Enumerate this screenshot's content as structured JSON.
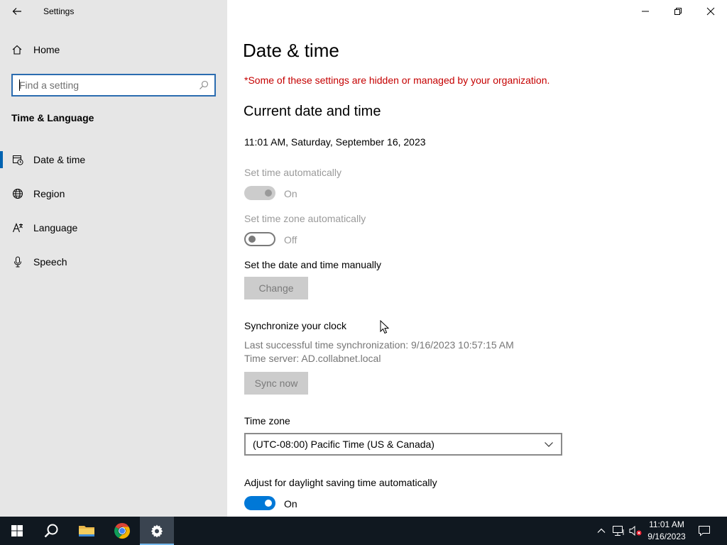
{
  "app": {
    "title": "Settings"
  },
  "sidebar": {
    "home_label": "Home",
    "search_placeholder": "Find a setting",
    "section_title": "Time & Language",
    "items": [
      {
        "label": "Date & time",
        "icon": "date-time-icon",
        "active": true
      },
      {
        "label": "Region",
        "icon": "globe-icon",
        "active": false
      },
      {
        "label": "Language",
        "icon": "language-icon",
        "active": false
      },
      {
        "label": "Speech",
        "icon": "microphone-icon",
        "active": false
      }
    ]
  },
  "main": {
    "title": "Date & time",
    "org_note": "*Some of these settings are hidden or managed by your organization.",
    "current_heading": "Current date and time",
    "current_value": "11:01 AM, Saturday, September 16, 2023",
    "set_time_auto": {
      "label": "Set time automatically",
      "state": "On",
      "enabled": false
    },
    "set_tz_auto": {
      "label": "Set time zone automatically",
      "state": "Off",
      "enabled": false
    },
    "manual": {
      "label": "Set the date and time manually",
      "button": "Change"
    },
    "sync": {
      "heading": "Synchronize your clock",
      "last_sync": "Last successful time synchronization: 9/16/2023 10:57:15 AM",
      "server": "Time server: AD.collabnet.local",
      "button": "Sync now"
    },
    "timezone": {
      "label": "Time zone",
      "value": "(UTC-08:00) Pacific Time (US & Canada)"
    },
    "dst": {
      "label": "Adjust for daylight saving time automatically",
      "state": "On"
    }
  },
  "taskbar": {
    "time": "11:01 AM",
    "date": "9/16/2023",
    "apps": [
      "start-icon",
      "search-icon",
      "file-explorer-icon",
      "chrome-icon",
      "settings-gear-icon"
    ]
  },
  "colors": {
    "accent": "#0078d7",
    "warning": "#c50000",
    "sidebar_bg": "#e6e6e6",
    "taskbar_bg": "#101820"
  }
}
